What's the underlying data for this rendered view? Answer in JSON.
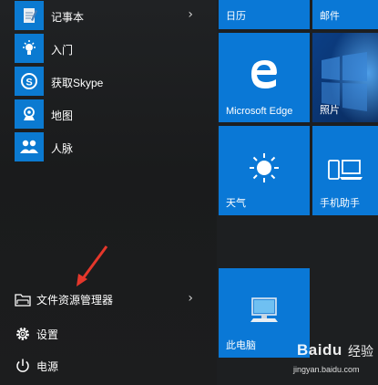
{
  "apps": [
    {
      "label": "记事本",
      "icon": "notepad-icon",
      "has_submenu": true
    },
    {
      "label": "入门",
      "icon": "lightbulb-icon",
      "has_submenu": false
    },
    {
      "label": "获取Skype",
      "icon": "skype-icon",
      "has_submenu": false
    },
    {
      "label": "地图",
      "icon": "maps-icon",
      "has_submenu": false
    },
    {
      "label": "人脉",
      "icon": "people-icon",
      "has_submenu": false
    }
  ],
  "system": {
    "file_explorer": "文件资源管理器",
    "settings": "设置",
    "power": "电源"
  },
  "tiles": {
    "calendar": "日历",
    "mail": "邮件",
    "edge": "Microsoft Edge",
    "photos": "照片",
    "weather": "天气",
    "phone_companion": "手机助手",
    "this_pc": "此电脑"
  },
  "watermark": {
    "logo": "Baidu",
    "text": "经验",
    "url": "jingyan.baidu.com"
  },
  "colors": {
    "accent": "#0a78d6",
    "background": "#1d1f21",
    "arrow": "#e5372b"
  }
}
